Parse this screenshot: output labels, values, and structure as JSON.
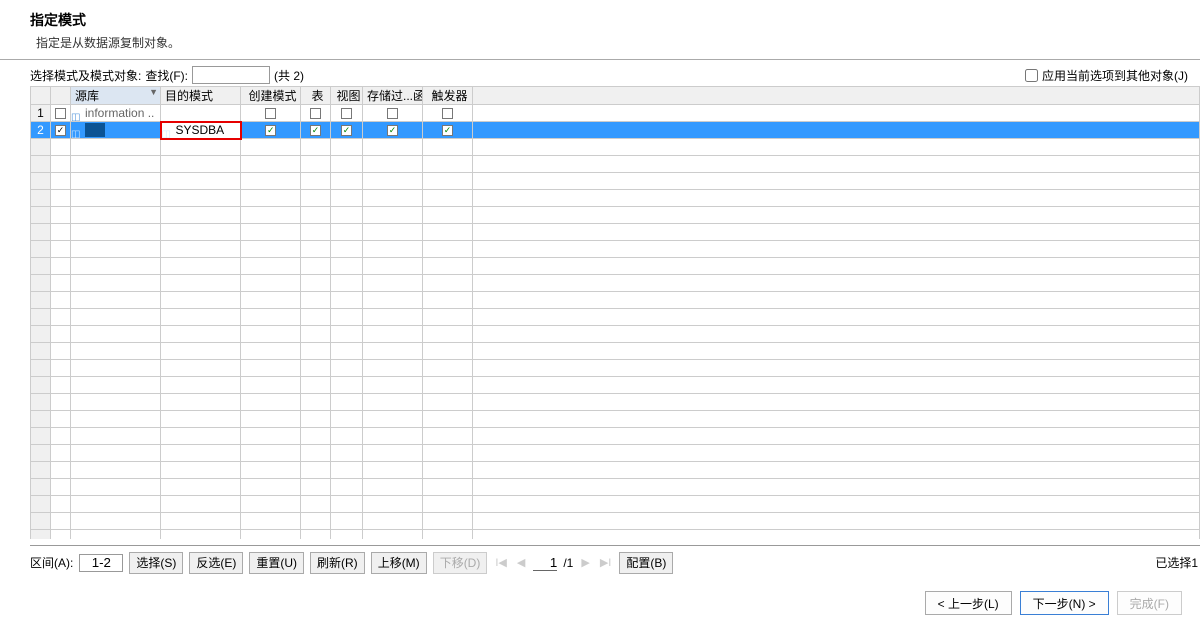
{
  "header": {
    "title": "指定模式",
    "subtitle": "指定是从数据源复制对象。"
  },
  "topbar": {
    "select_label": "选择模式及模式对象:",
    "find_label": "查找(F):",
    "total_label": "(共 2)",
    "apply_other": "应用当前选项到其他对象(J)"
  },
  "columns": {
    "source": "源库",
    "target": "目的模式",
    "create": "创建模式",
    "table": "表",
    "view": "视图",
    "proc": "存储过...函数",
    "trigger": "触发器"
  },
  "rows": [
    {
      "num": "1",
      "checked": false,
      "source": "information ..",
      "target": "",
      "create": "empty",
      "table": "empty",
      "view": "empty",
      "proc": "empty",
      "trig": "empty",
      "selected": false
    },
    {
      "num": "2",
      "checked": true,
      "source": "",
      "target": "SYSDBA",
      "create": "on",
      "table": "on",
      "view": "on",
      "proc": "on",
      "trig": "on",
      "selected": true,
      "highlight_target": true
    }
  ],
  "bottombar": {
    "range_label": "区间(A):",
    "range_value": "1-2",
    "select_btn": "选择(S)",
    "invert_btn": "反选(E)",
    "reset_btn": "重置(U)",
    "refresh_btn": "刷新(R)",
    "moveup_btn": "上移(M)",
    "movedown_btn": "下移(D)",
    "page_cur": "1",
    "page_total": "/1",
    "config_btn": "配置(B)",
    "status": "已选择1"
  },
  "footer": {
    "prev": "< 上一步(L)",
    "next": "下一步(N) >",
    "finish": "完成(F)"
  }
}
